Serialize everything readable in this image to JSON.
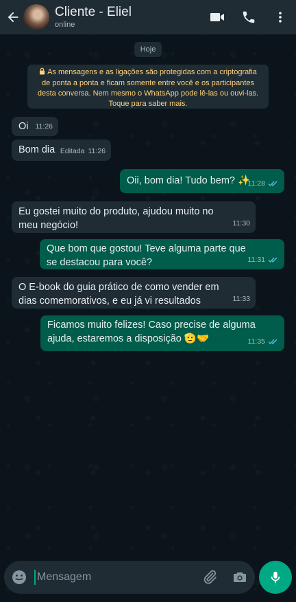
{
  "header": {
    "contact_name": "Cliente - Eliel",
    "status": "online"
  },
  "date_chip": "Hoje",
  "encryption_notice": "As mensagens e as ligações são protegidas com a criptografia de ponta a ponta e ficam somente entre você e os participantes desta conversa. Nem mesmo o WhatsApp pode lê-las ou ouvi-las. Toque para saber mais.",
  "messages": [
    {
      "direction": "in",
      "text": "Oi",
      "time": "11:26"
    },
    {
      "direction": "in",
      "text": "Bom dia",
      "edited": "Editada",
      "time": "11:26"
    },
    {
      "direction": "out",
      "text": "Oii, bom dia! Tudo bem? ✨",
      "time": "11:28",
      "status": "read"
    },
    {
      "direction": "in",
      "text": "Eu gostei muito do produto, ajudou muito no meu negócio!",
      "time": "11:30"
    },
    {
      "direction": "out",
      "text": "Que bom que gostou! Teve alguma parte que se destacou para você?",
      "time": "11:31",
      "status": "read"
    },
    {
      "direction": "in",
      "text": "O E-book do guia prático de como vender em dias comemorativos, e eu já vi resultados",
      "time": "11:33"
    },
    {
      "direction": "out",
      "text": "Ficamos muito felizes! Caso precise de alguma ajuda, estaremos a disposição 🫡🤝",
      "time": "11:35",
      "status": "read"
    }
  ],
  "input": {
    "placeholder": "Mensagem"
  },
  "colors": {
    "header_bg": "#1f2c34",
    "incoming_bubble": "#1f2c34",
    "outgoing_bubble": "#005c4b",
    "accent": "#00a884",
    "read_tick": "#53bdeb",
    "encryption_text": "#ffd279"
  },
  "icons": [
    "back-arrow-icon",
    "video-call-icon",
    "phone-icon",
    "more-vert-icon",
    "lock-icon",
    "double-check-icon",
    "emoji-icon",
    "paperclip-icon",
    "camera-icon",
    "mic-icon"
  ]
}
